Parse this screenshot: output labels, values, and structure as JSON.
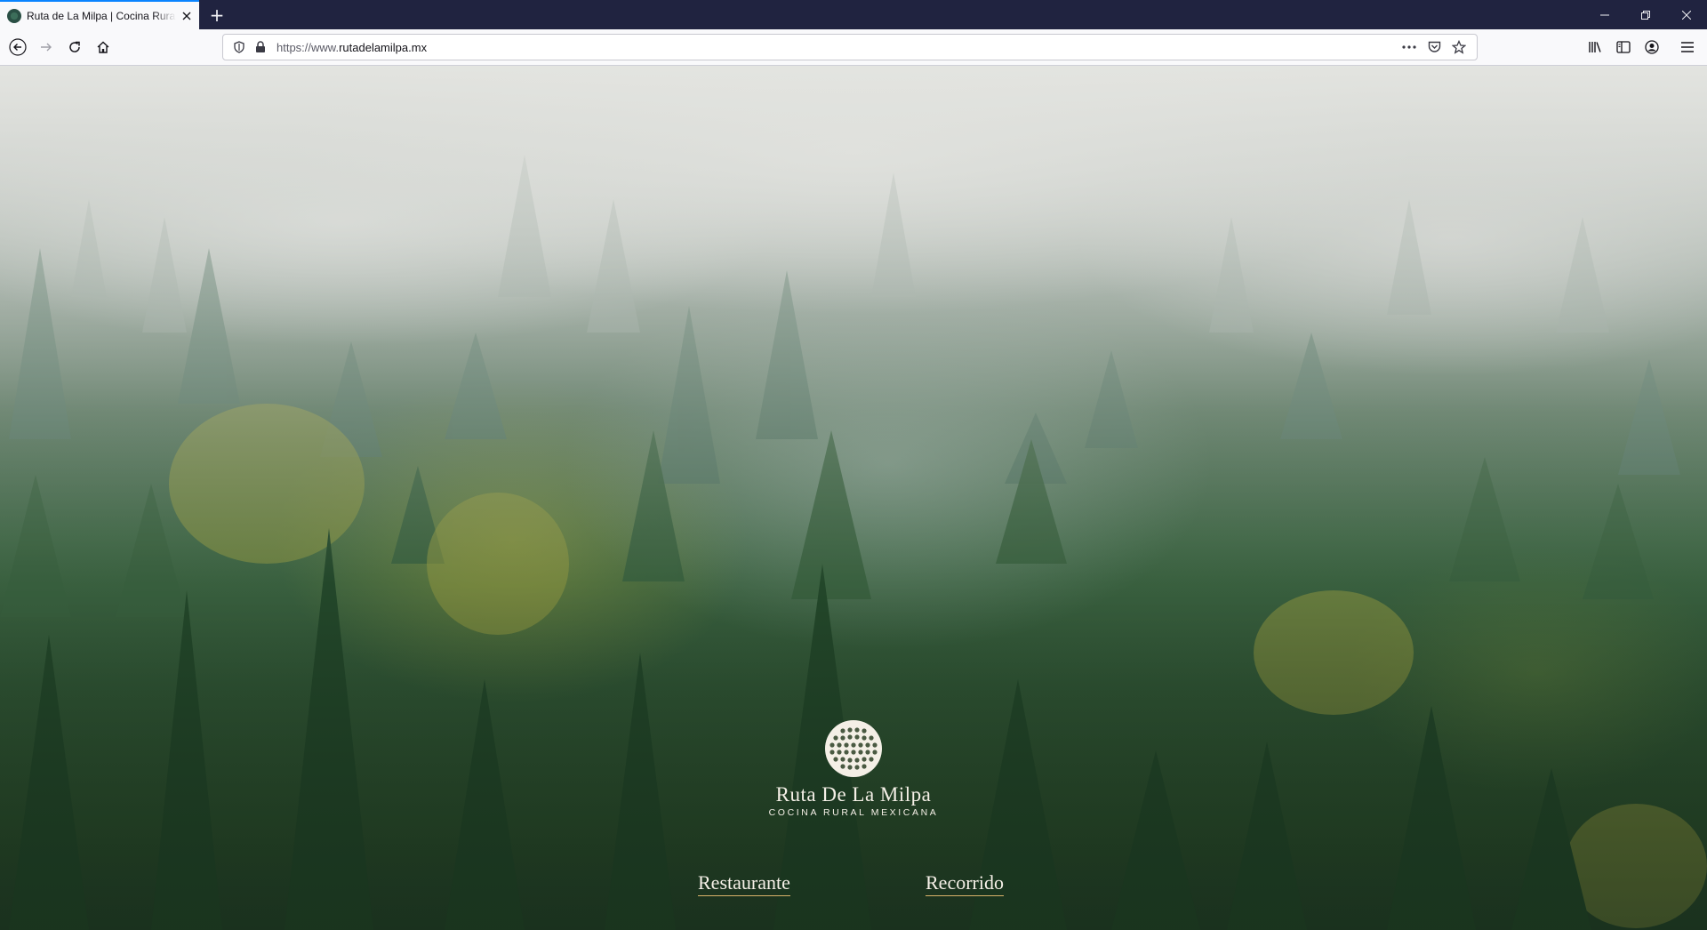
{
  "browser": {
    "tab": {
      "title": "Ruta de La Milpa | Cocina Rural Mexicana",
      "favicon": "tree-favicon-icon"
    },
    "new_tab_label": "+",
    "window_controls": [
      "minimize-icon",
      "restore-icon",
      "close-icon"
    ],
    "url": {
      "prefix": "https://www.",
      "host": "rutadelamilpa.mx"
    },
    "icons": {
      "back": "arrow-left-icon",
      "forward": "arrow-right-icon",
      "reload": "reload-icon",
      "home": "home-icon",
      "shield": "tracking-shield-icon",
      "lock": "lock-icon",
      "more": "more-dots-icon",
      "pocket": "pocket-icon",
      "bookmark": "star-icon",
      "library": "library-icon",
      "sidebar": "sidebar-icon",
      "account": "account-icon",
      "menu": "hamburger-menu-icon"
    }
  },
  "page": {
    "brand": {
      "name": "Ruta De La Milpa",
      "tagline": "COCINA RURAL MEXICANA",
      "logo_icon": "corn-cob-logo-icon"
    },
    "links": {
      "restaurant": "Restaurante",
      "tour": "Recorrido"
    },
    "colors": {
      "text": "#f4efe6",
      "link_underline": "#d9b36a",
      "tab_accent": "#0a84ff"
    }
  }
}
